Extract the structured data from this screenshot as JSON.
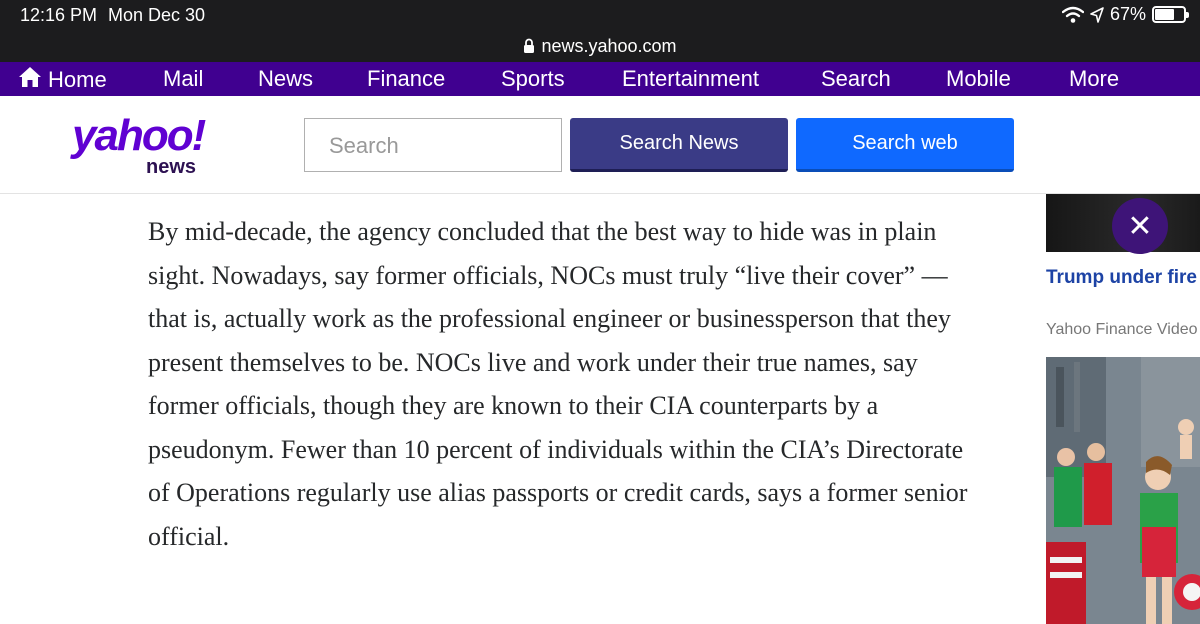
{
  "status": {
    "time": "12:16 PM",
    "date": "Mon Dec 30",
    "battery": "67%",
    "battery_level": 0.67
  },
  "browser": {
    "url": "news.yahoo.com"
  },
  "nav": {
    "items": [
      {
        "label": "Home",
        "icon": "home-icon"
      },
      {
        "label": "Mail"
      },
      {
        "label": "News"
      },
      {
        "label": "Finance"
      },
      {
        "label": "Sports"
      },
      {
        "label": "Entertainment"
      },
      {
        "label": "Search"
      },
      {
        "label": "Mobile"
      },
      {
        "label": "More"
      }
    ]
  },
  "header": {
    "logo_main": "yahoo!",
    "logo_sub": "news",
    "search_placeholder": "Search",
    "search_news_label": "Search News",
    "search_web_label": "Search web"
  },
  "article": {
    "paragraph": "By mid-decade, the agency concluded that the best way to hide was in plain sight. Nowadays, say former officials, NOCs must truly “live their cover” — that is, actually work as the professional engineer or businessperson that they present themselves to be. NOCs live and work under their true names, say former officials, though they are known to their CIA counterparts by a pseudonym. Fewer than 10 percent of individuals within the CIA’s Directorate of Operations regularly use alias passports or credit cards, says a former senior official."
  },
  "rail": {
    "headline": "Trump under fire whistleblower",
    "source": "Yahoo Finance Video",
    "close_label": "✕"
  },
  "colors": {
    "nav_bg": "#400090",
    "brand": "#6001d2",
    "search_news_bg": "#3a3b86",
    "search_web_bg": "#0f69ff",
    "headline": "#1d43a5"
  }
}
